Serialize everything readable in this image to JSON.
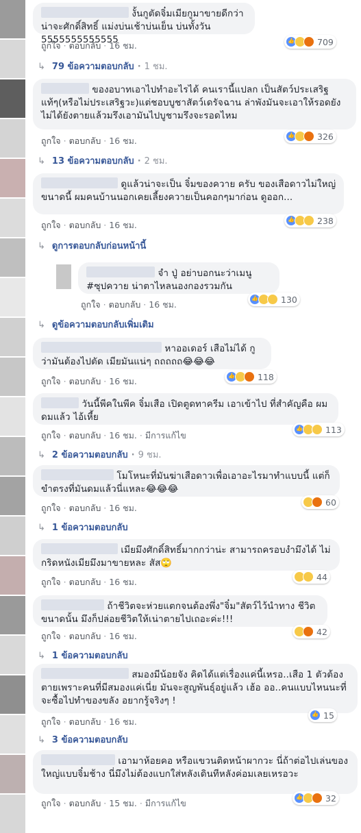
{
  "strip_colors": [
    "#9b9b9b",
    "#d8d8d8",
    "#5e5e5e",
    "#d4d4d4",
    "#c9b0b0",
    "#dcdcdc",
    "#bfbfbf",
    "#e8e8e8",
    "#d0d0d0",
    "#c7c7c7",
    "#e3e3e3",
    "#bcbcbc",
    "#a3a3a3",
    "#cfcfcf",
    "#c4aeae",
    "#9a9a9a",
    "#d9d9d9",
    "#8f8f8f",
    "#e0e0e0",
    "#bdb0b0",
    "#d7d7d7"
  ],
  "labels": {
    "like": "ถูกใจ",
    "reply": "ตอบกลับ",
    "edited": "มีการแก้ไข"
  },
  "comments": [
    {
      "text": "งั้นกูตัดจิ๋มเมียกูมาขายดีกว่า น่าจะศักดิ์สิทธิ์ แม่งบ่นเช้าบ่นเย็น บ่นทั้งวัน 5555555555555",
      "time": "16 ชม.",
      "count": "709"
    },
    {
      "text": "ของอบาทเอาไปทำอะไรได้ คนเรานี้แปลก เป็นสัตว์ประเสริฐแท้ๆ(หรือไม่ประเสริฐวะ)แต่ชอบบูชาสัตว์เดรัจฉาน ล่าพังมันจะเอาให้รอดยังไม่ได้ยังตายแล้วมรึงเอามันไปบูชามรึงจะรอดไหม",
      "time": "16 ชม.",
      "count": "326"
    },
    {
      "text": "ดูแล้วน่าจะเป็น จิ๋มของควาย ครับ ของเสือดาวไม่ใหญ่ขนาดนี้ ผมคนบ้านนอกเคยเลี้ยงควายเป็นคอกๆมาก่อน ดูออก...",
      "time": "16 ชม.",
      "count": "238"
    },
    {
      "text": "จำ ปู่ อย่าบอกนะว่าเมนู #ซุปควาย น่าตาไหลนองกองรวมกัน",
      "time": "16 ชม.",
      "count": "130"
    },
    {
      "text": "หาออเดอร์ เสือไม่ได้ กูว่ามันต้องไปตัด เมียมันแน่ๆ ถถถถถ😂😂😂",
      "time": "16 ชม.",
      "count": "118"
    },
    {
      "text": "วันนี้พีคในพีค จิ๋มเสือ เปิดตูดทาครีม เอาเข้าไป ที่สำคัญคือ ผมดมแล้ว ไอ้เหี้ย",
      "time": "16 ชม.",
      "count": "113"
    },
    {
      "text": "โมโหนะที่มันฆ่าเสือดาวเพื่อเอาอะไรมาทำแบบนี้ แต่ก็ขำตรงที่มันดมแล้วนี่แหละ😂😂😂",
      "time": "16 ชม.",
      "count": "60"
    },
    {
      "text": "เมียมึงศักดิ์สิทธิ์มากกว่าน่ะ สามารถครอบงำมึงได้ ไม่กริดหนังเมียมึงมาขายหละ สัส🙄",
      "time": "16 ชม.",
      "count": "44"
    },
    {
      "text": "ถ้าชีวิตจะห่วยแตกจนต้องพึ่ง\"จิ๋ม\"สัตว์ไว้นำทาง ชีวิตขนาดนั้น มึงก็ปล่อยชีวิตให้เน่าตายไปเถอะค่ะ!!!",
      "time": "16 ชม.",
      "count": "42"
    },
    {
      "text": "สมองมีน้อยจัง คิดได้แต่เรื่องแค่นี้เหรอ..เสือ 1 ตัวต้องตายเพราะคนที่มีสมองแค่เนี่ย มันจะสูญพันธุ์อยู่แล้ว เฮ้อ ออ..คนแบบไหนนะที่จะซื้อไปทำของขลัง อยากรู้จริงๆ !",
      "time": "16 ชม.",
      "count": "15"
    },
    {
      "text": "เอามาห้อยคอ หรือแขวนติดหน้าผากวะ นี่ถ้าต่อไปเล่นของใหญ่แบบจิ๋มช้าง นี่มึงไม่ต้องแบกใส่หลังเดินทีหลังค่อมเลยเหรอวะ",
      "time": "15 ชม.",
      "count": "32"
    }
  ],
  "replies": [
    {
      "text": "79 ข้อความตอบกลับ",
      "time": "1 ชม."
    },
    {
      "text": "13 ข้อความตอบกลับ",
      "time": "2 ชม."
    },
    {
      "text": "ดูการตอบกลับก่อนหน้านี้",
      "time": ""
    },
    {
      "text": "ดูข้อความตอบกลับเพิ่มเติม",
      "time": ""
    },
    {
      "text": "2 ข้อความตอบกลับ",
      "time": "9 ชม."
    },
    {
      "text": "1 ข้อความตอบกลับ",
      "time": ""
    },
    {
      "text": "1 ข้อความตอบกลับ",
      "time": ""
    },
    {
      "text": "3 ข้อความตอบกลับ",
      "time": ""
    }
  ]
}
